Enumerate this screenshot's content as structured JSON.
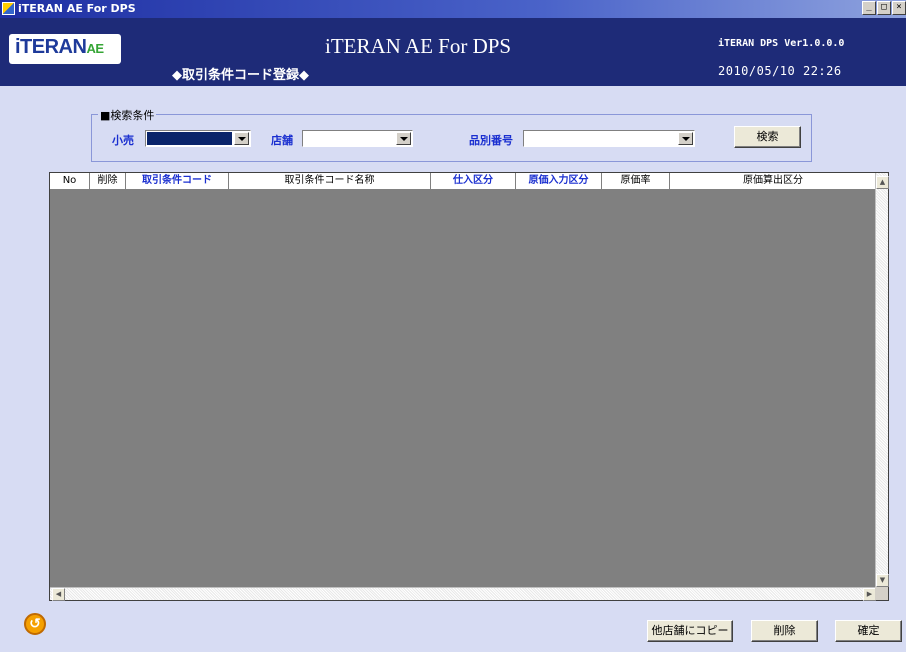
{
  "window": {
    "title": "iTERAN AE For DPS",
    "controls": [
      "_",
      "□",
      "×"
    ]
  },
  "header": {
    "logo_text": "iTERAN",
    "logo_suffix": "AE",
    "app_title": "iTERAN AE For DPS",
    "screen_title": "◆取引条件コード登録◆",
    "version": "iTERAN DPS Ver1.0.0.0",
    "datetime": "2010/05/10 22:26"
  },
  "search": {
    "group_label": "■検索条件",
    "retail_label": "小売",
    "retail_value": "",
    "store_label": "店舗",
    "store_value": "",
    "item_no_label": "品別番号",
    "item_no_value": "",
    "search_button": "検索"
  },
  "grid": {
    "columns": [
      {
        "label": "No",
        "highlight": false
      },
      {
        "label": "削除",
        "highlight": false
      },
      {
        "label": "取引条件コード",
        "highlight": true
      },
      {
        "label": "取引条件コード名称",
        "highlight": false
      },
      {
        "label": "仕入区分",
        "highlight": true
      },
      {
        "label": "原価入力区分",
        "highlight": true
      },
      {
        "label": "原価率",
        "highlight": false
      },
      {
        "label": "原価算出区分",
        "highlight": false
      }
    ],
    "rows": []
  },
  "footer": {
    "back_icon": "back-arrow-icon",
    "copy_button": "他店舗にコピー",
    "delete_button": "削除",
    "confirm_button": "確定"
  },
  "colors": {
    "banner": "#1e2b78",
    "background": "#d7dcf3",
    "header_highlight": "#1a2fd0",
    "grid_body": "#808080"
  }
}
